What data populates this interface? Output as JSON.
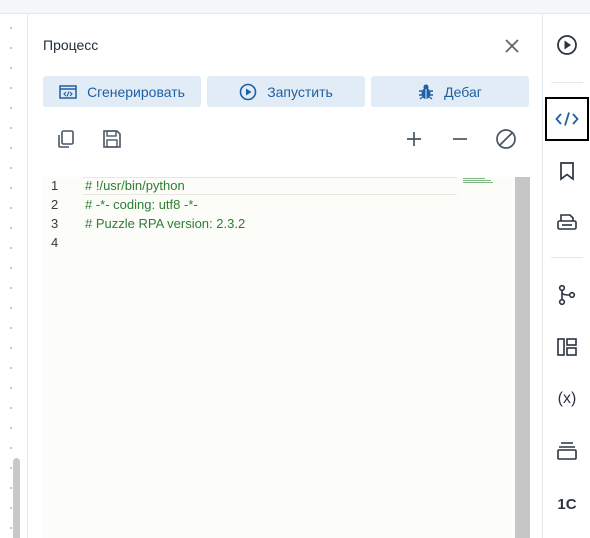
{
  "panel": {
    "title": "Процесс",
    "actions": [
      {
        "label": "Сгенерировать",
        "icon": "code-window-icon"
      },
      {
        "label": "Запустить",
        "icon": "play-circle-icon"
      },
      {
        "label": "Дебаг",
        "icon": "bug-icon"
      }
    ],
    "toolbar_icons": [
      "copy-icon",
      "save-icon",
      "zoom-in-icon",
      "zoom-out-icon",
      "block-icon"
    ]
  },
  "editor": {
    "line_numbers": [
      "1",
      "2",
      "3",
      "4"
    ],
    "lines": [
      "# !/usr/bin/python",
      "# -*- coding: utf8 -*-",
      "# Puzzle RPA version: 2.3.2",
      ""
    ]
  },
  "right_bar": {
    "items": [
      {
        "icon": "play-circle-icon",
        "active": false
      },
      {
        "icon": "code-icon",
        "active": true
      },
      {
        "icon": "bookmark-icon",
        "active": false
      },
      {
        "icon": "printer-icon",
        "active": false
      },
      {
        "icon": "branch-icon",
        "active": false
      },
      {
        "icon": "layout-icon",
        "active": false
      },
      {
        "icon": "variable-icon",
        "active": false,
        "text": "(x)"
      },
      {
        "icon": "layers-icon",
        "active": false
      },
      {
        "icon": "1c-icon",
        "active": false,
        "text": "1С"
      }
    ]
  },
  "colors": {
    "accent": "#1f5fa3",
    "button_bg": "#e2ecf6",
    "code_comment": "#2d7d32",
    "editor_bg": "#fcfcf9"
  }
}
